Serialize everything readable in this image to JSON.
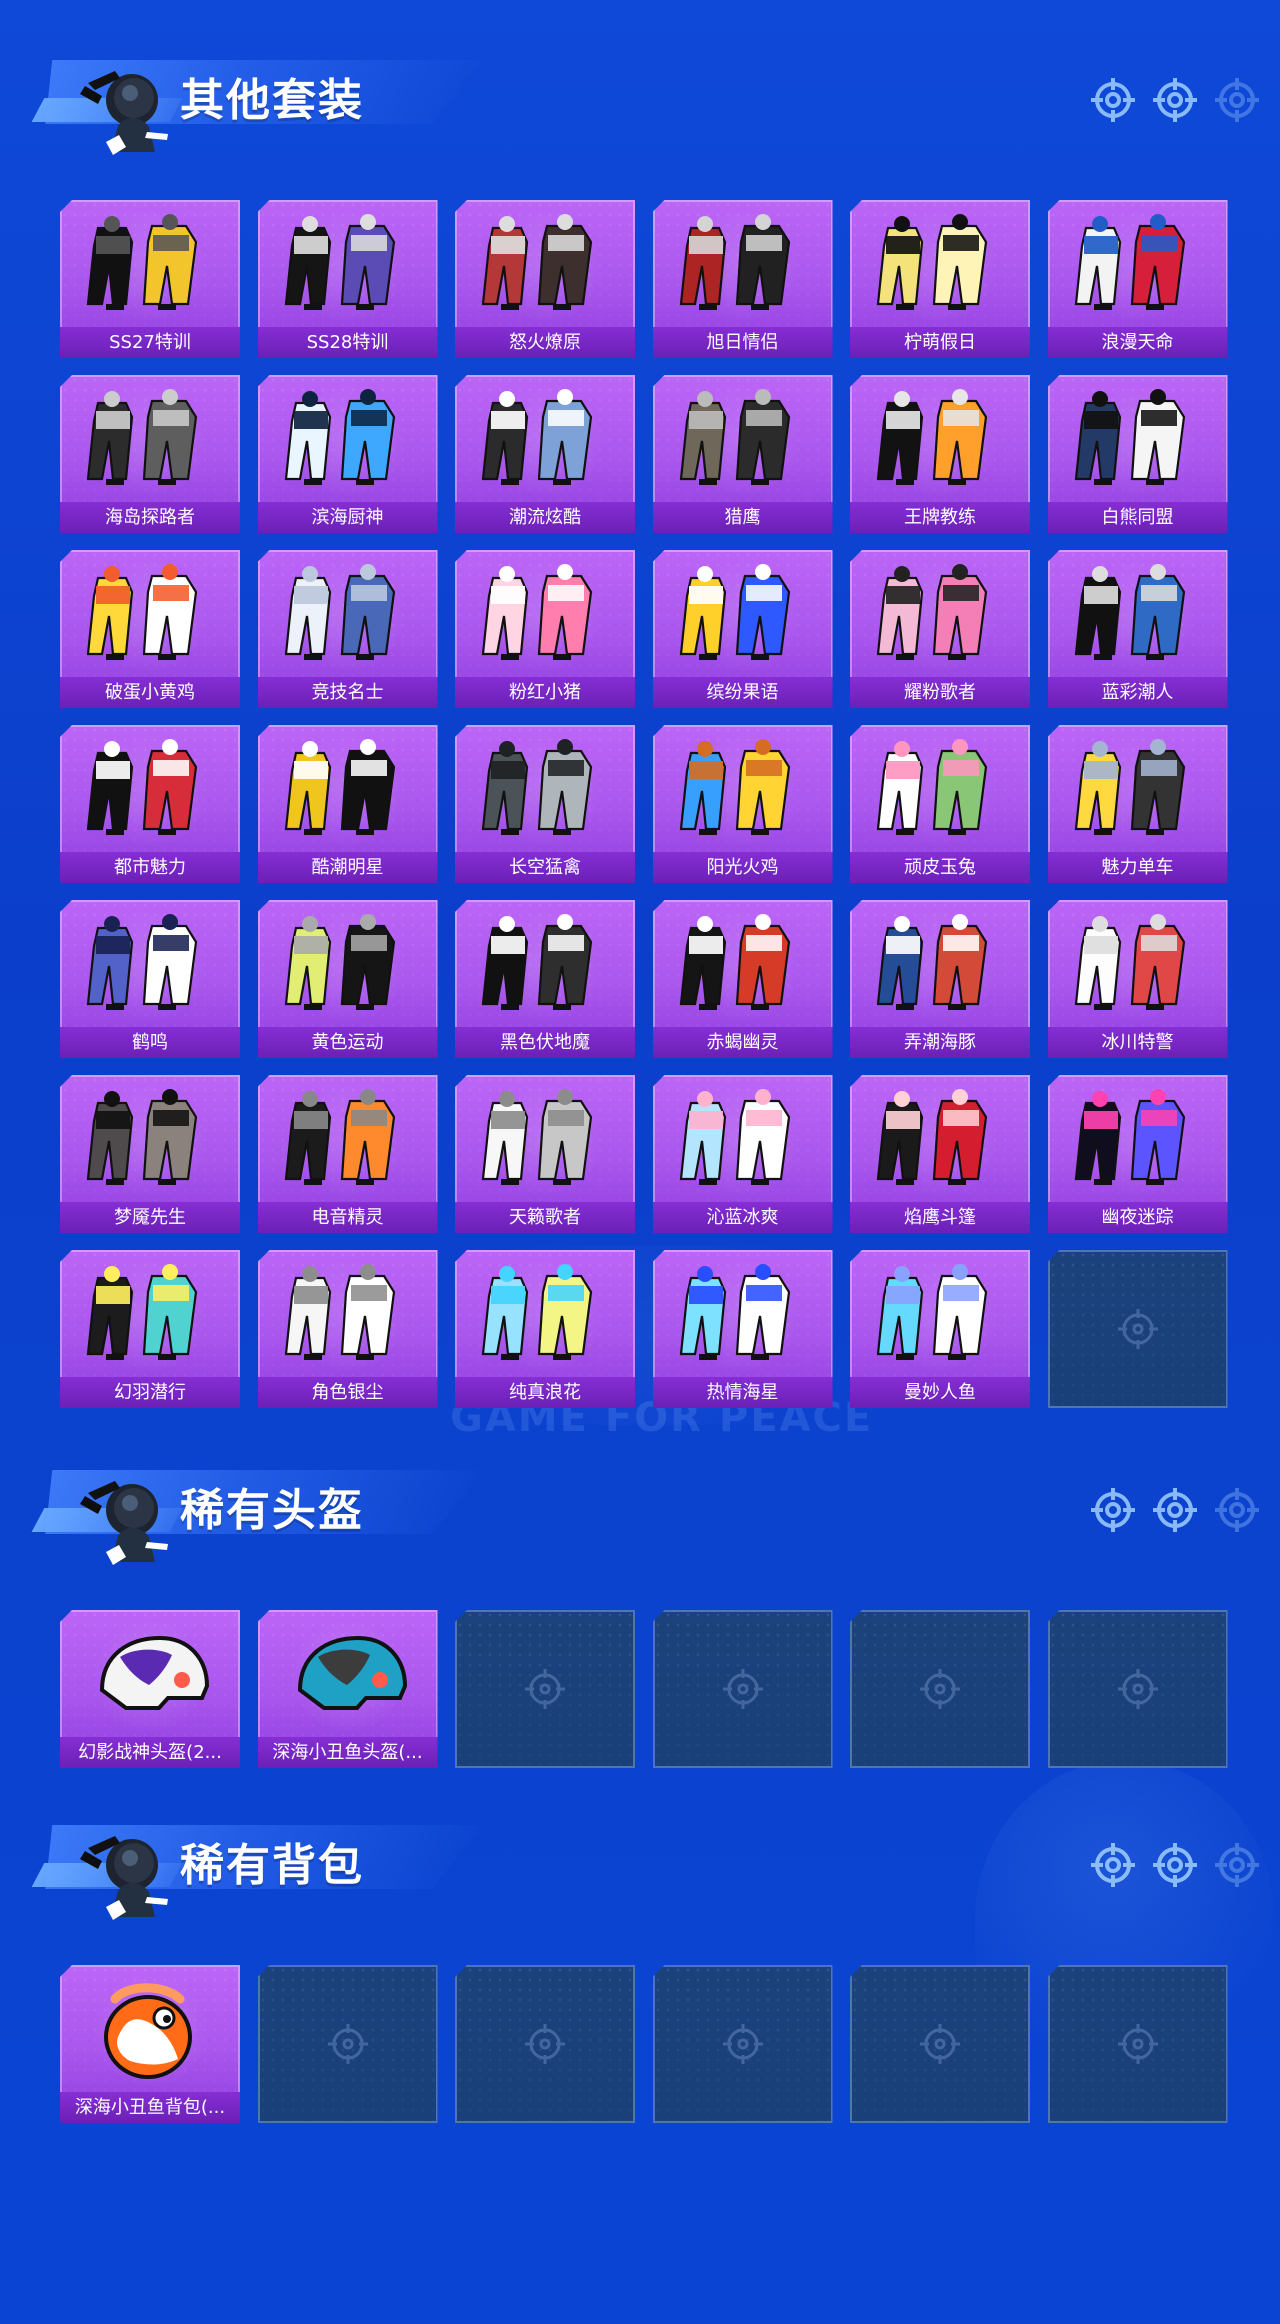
{
  "background": {
    "watermark": "GAME FOR PEACE"
  },
  "colors": {
    "page_background": "#0b42d0",
    "card_filled": "#a956ed",
    "card_label": "#7a28c6",
    "card_empty": "#1b417c"
  },
  "icons": {
    "section_target": "target-icon",
    "empty_slot": "target-icon",
    "mascot": "mascot-icon"
  },
  "sections": [
    {
      "title": "其他套装",
      "items": [
        {
          "label": "SS27特训",
          "icon": "outfit-icon"
        },
        {
          "label": "SS28特训",
          "icon": "outfit-icon"
        },
        {
          "label": "怒火燎原",
          "icon": "outfit-icon"
        },
        {
          "label": "旭日情侣",
          "icon": "outfit-icon"
        },
        {
          "label": "柠萌假日",
          "icon": "outfit-icon"
        },
        {
          "label": "浪漫天命",
          "icon": "outfit-icon"
        },
        {
          "label": "海岛探路者",
          "icon": "outfit-icon"
        },
        {
          "label": "滨海厨神",
          "icon": "outfit-icon"
        },
        {
          "label": "潮流炫酷",
          "icon": "outfit-icon"
        },
        {
          "label": "猎鹰",
          "icon": "outfit-icon"
        },
        {
          "label": "王牌教练",
          "icon": "outfit-icon"
        },
        {
          "label": "白熊同盟",
          "icon": "outfit-icon"
        },
        {
          "label": "破蛋小黄鸡",
          "icon": "outfit-icon"
        },
        {
          "label": "竞技名士",
          "icon": "outfit-icon"
        },
        {
          "label": "粉红小猪",
          "icon": "outfit-icon"
        },
        {
          "label": "缤纷果语",
          "icon": "outfit-icon"
        },
        {
          "label": "耀粉歌者",
          "icon": "outfit-icon"
        },
        {
          "label": "蓝彩潮人",
          "icon": "outfit-icon"
        },
        {
          "label": "都市魅力",
          "icon": "outfit-icon"
        },
        {
          "label": "酷潮明星",
          "icon": "outfit-icon"
        },
        {
          "label": "长空猛禽",
          "icon": "outfit-icon"
        },
        {
          "label": "阳光火鸡",
          "icon": "outfit-icon"
        },
        {
          "label": "顽皮玉兔",
          "icon": "outfit-icon"
        },
        {
          "label": "魅力单车",
          "icon": "outfit-icon"
        },
        {
          "label": "鹤鸣",
          "icon": "outfit-icon"
        },
        {
          "label": "黄色运动",
          "icon": "outfit-icon"
        },
        {
          "label": "黑色伏地魔",
          "icon": "outfit-icon"
        },
        {
          "label": "赤蝎幽灵",
          "icon": "outfit-icon"
        },
        {
          "label": "弄潮海豚",
          "icon": "outfit-icon"
        },
        {
          "label": "冰川特警",
          "icon": "outfit-icon"
        },
        {
          "label": "梦魇先生",
          "icon": "outfit-icon"
        },
        {
          "label": "电音精灵",
          "icon": "outfit-icon"
        },
        {
          "label": "天籁歌者",
          "icon": "outfit-icon"
        },
        {
          "label": "沁蓝冰爽",
          "icon": "outfit-icon"
        },
        {
          "label": "焰鹰斗篷",
          "icon": "outfit-icon"
        },
        {
          "label": "幽夜迷踪",
          "icon": "outfit-icon"
        },
        {
          "label": "幻羽潜行",
          "icon": "outfit-icon"
        },
        {
          "label": "角色银尘",
          "icon": "outfit-icon"
        },
        {
          "label": "纯真浪花",
          "icon": "outfit-icon"
        },
        {
          "label": "热情海星",
          "icon": "outfit-icon"
        },
        {
          "label": "曼妙人鱼",
          "icon": "outfit-icon"
        },
        {
          "label": "",
          "empty": true
        }
      ]
    },
    {
      "title": "稀有头盔",
      "items": [
        {
          "label": "幻影战神头盔(2...",
          "icon": "helmet-icon"
        },
        {
          "label": "深海小丑鱼头盔(...",
          "icon": "helmet-icon"
        },
        {
          "label": "",
          "empty": true
        },
        {
          "label": "",
          "empty": true
        },
        {
          "label": "",
          "empty": true
        },
        {
          "label": "",
          "empty": true
        }
      ]
    },
    {
      "title": "稀有背包",
      "items": [
        {
          "label": "深海小丑鱼背包(...",
          "icon": "backpack-icon"
        },
        {
          "label": "",
          "empty": true
        },
        {
          "label": "",
          "empty": true
        },
        {
          "label": "",
          "empty": true
        },
        {
          "label": "",
          "empty": true
        },
        {
          "label": "",
          "empty": true
        }
      ]
    }
  ]
}
